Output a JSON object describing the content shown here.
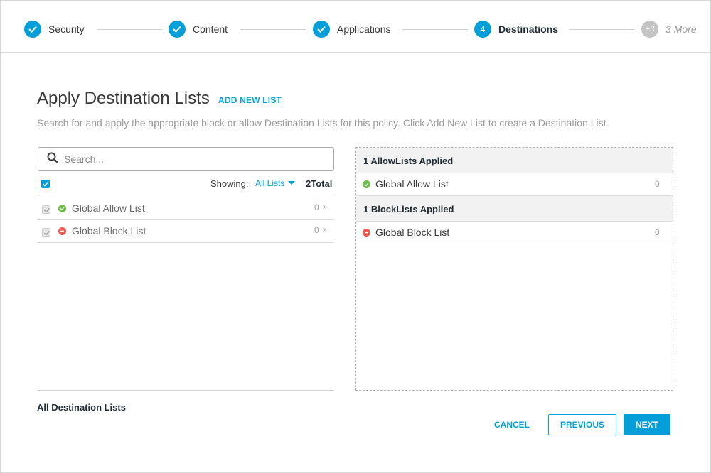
{
  "stepper": {
    "steps": [
      {
        "label": "Security",
        "state": "complete",
        "icon": "check-icon"
      },
      {
        "label": "Content",
        "state": "complete",
        "icon": "check-icon"
      },
      {
        "label": "Applications",
        "state": "complete",
        "icon": "check-icon"
      },
      {
        "label": "Destinations",
        "state": "active",
        "number": "4"
      },
      {
        "label": "3 More",
        "state": "more",
        "number": "+3"
      }
    ]
  },
  "page": {
    "title": "Apply Destination Lists",
    "add_new_label": "ADD NEW LIST",
    "description": "Search for and apply the appropriate block or allow Destination Lists for this policy. Click Add New List to create a Destination List."
  },
  "search": {
    "placeholder": "Search...",
    "value": ""
  },
  "list_header": {
    "showing_label": "Showing:",
    "filter_value": "All Lists",
    "total": "2Total"
  },
  "lists": [
    {
      "label": "Global Allow List",
      "type": "allow",
      "count": "0",
      "checked": true
    },
    {
      "label": "Global Block List",
      "type": "block",
      "count": "0",
      "checked": true
    }
  ],
  "left_footer": {
    "label": "All Destination Lists"
  },
  "applied": {
    "allow_header": "1 AllowLists Applied",
    "allow_items": [
      {
        "label": "Global Allow List",
        "count": "0"
      }
    ],
    "block_header": "1 BlockLists Applied",
    "block_items": [
      {
        "label": "Global Block List",
        "count": "0"
      }
    ]
  },
  "buttons": {
    "cancel": "CANCEL",
    "previous": "PREVIOUS",
    "next": "NEXT"
  },
  "colors": {
    "accent": "#049fd9",
    "allow": "#6cc04a",
    "block": "#e2231a",
    "inactive_step": "#c4c4c4"
  }
}
